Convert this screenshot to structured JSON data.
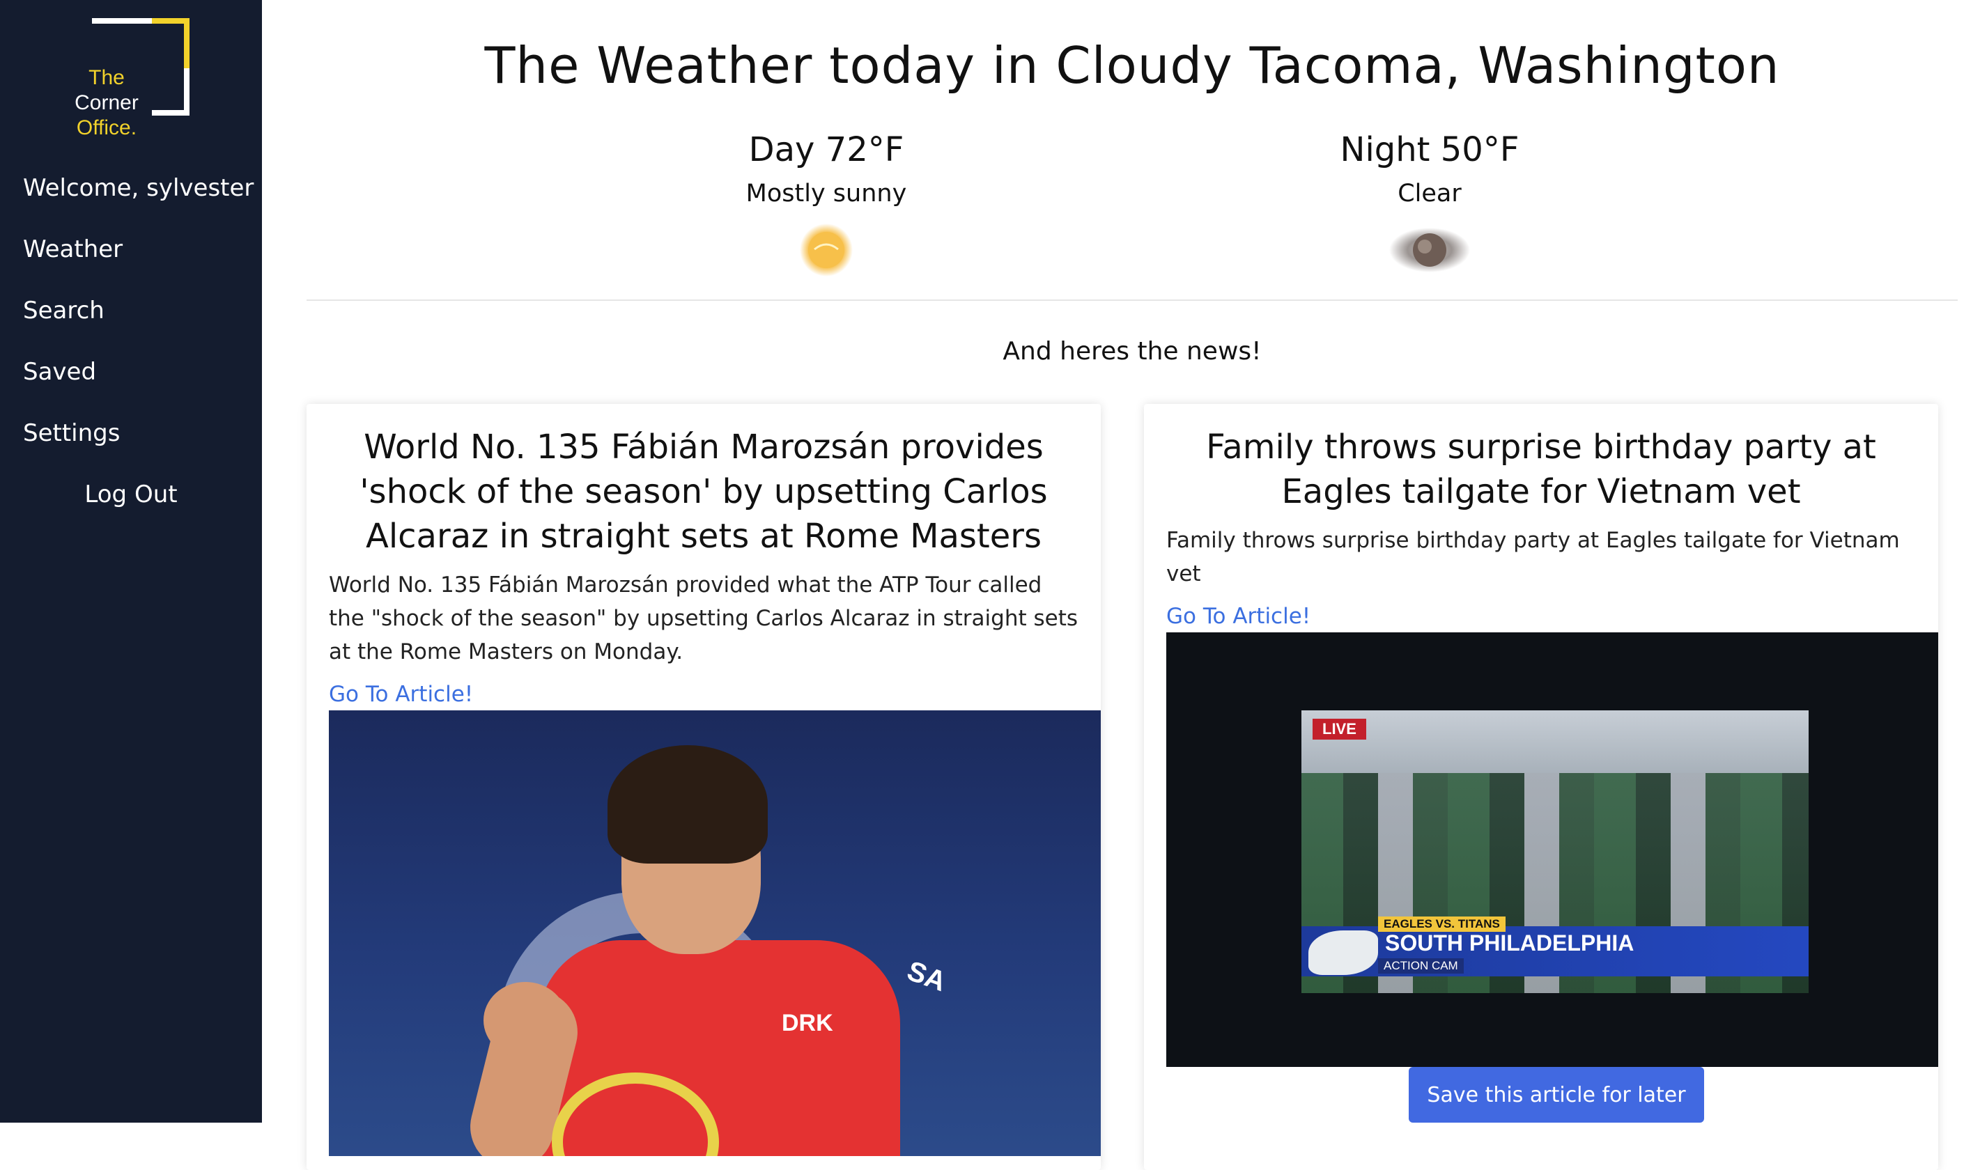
{
  "logo": {
    "line1": "The",
    "line2": "Corner",
    "line3": "Office."
  },
  "nav": {
    "welcome": "Welcome, sylvester",
    "weather": "Weather",
    "search": "Search",
    "saved": "Saved",
    "settings": "Settings",
    "logout": "Log Out"
  },
  "weather": {
    "title": "The Weather today in Cloudy Tacoma, Washington",
    "day": {
      "temp": "Day 72°F",
      "desc": "Mostly sunny",
      "icon": "sun-icon"
    },
    "night": {
      "temp": "Night 50°F",
      "desc": "Clear",
      "icon": "moon-icon"
    }
  },
  "news": {
    "heading": "And heres the news!",
    "articles": [
      {
        "title": "World No. 135 Fábián Marozsán provides 'shock of the season' by upsetting Carlos Alcaraz in straight sets at Rome Masters",
        "desc": "World No. 135 Fábián Marozsán provided what the ATP Tour called the \"shock of the season\" by upsetting Carlos Alcaraz in straight sets at the Rome Masters on Monday.",
        "link": "Go To Article!",
        "image": {
          "logo1": "DRK",
          "logo2": "SA"
        }
      },
      {
        "title": "Family throws surprise birthday party at Eagles tailgate for Vietnam vet",
        "desc": "Family throws surprise birthday party at Eagles tailgate for Vietnam vet",
        "link": "Go To Article!",
        "image": {
          "live": "LIVE",
          "tag": "EAGLES VS. TITANS",
          "headline": "SOUTH PHILADELPHIA",
          "sub": "ACTION CAM"
        },
        "save_label": "Save this article for later"
      }
    ]
  },
  "colors": {
    "sidebar": "#141c2f",
    "accent_yellow": "#f2d22b",
    "link": "#3b6fe0",
    "button": "#4169e1"
  }
}
